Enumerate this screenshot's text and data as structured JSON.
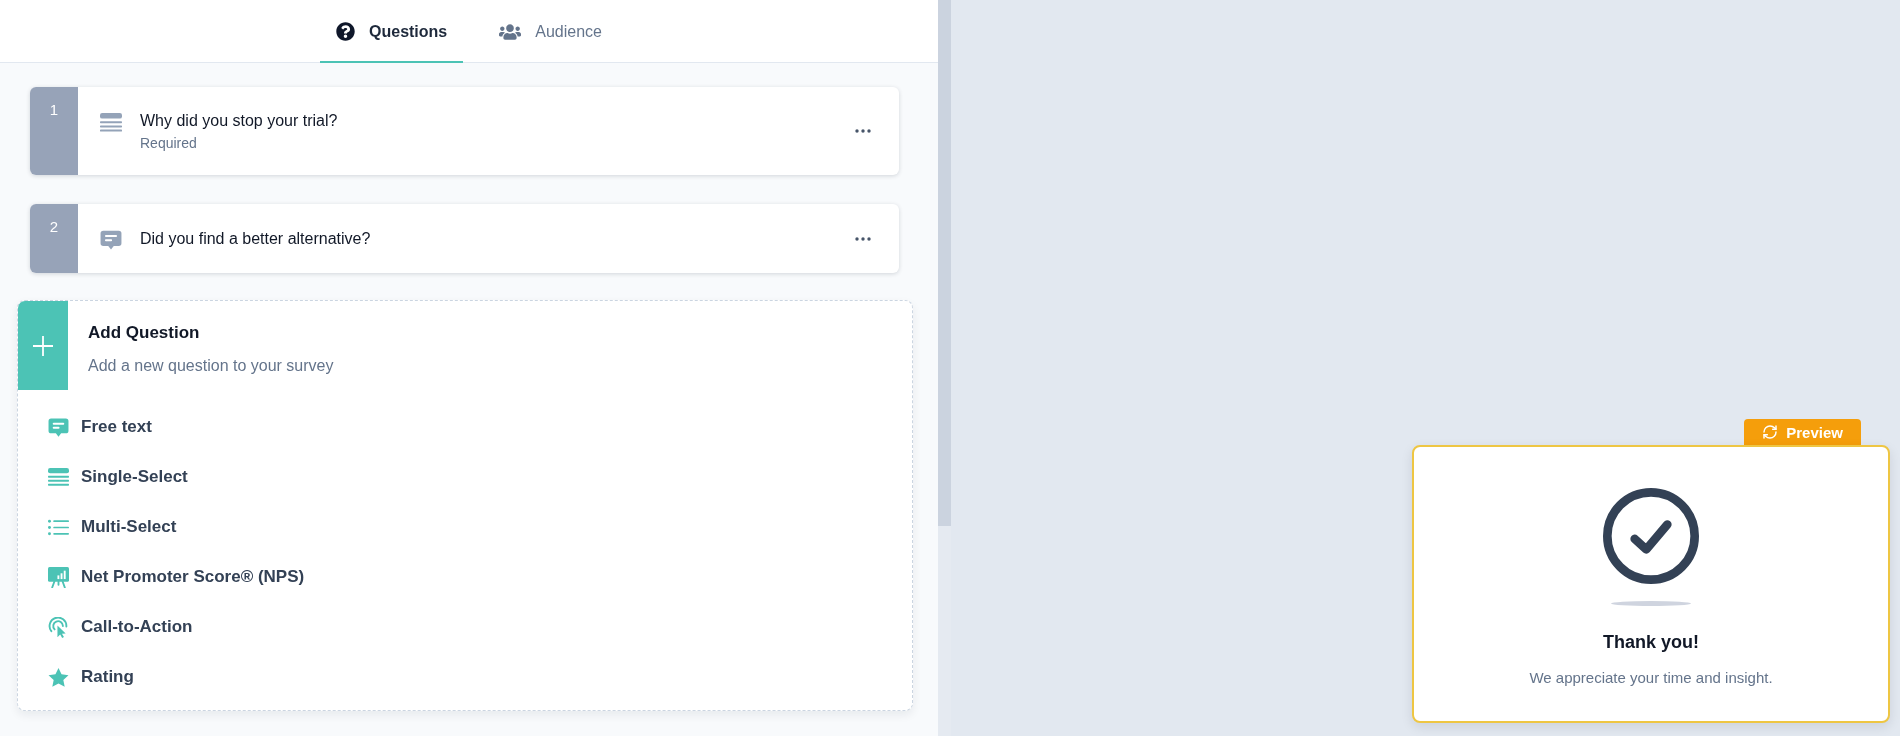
{
  "tabs": [
    {
      "label": "Questions",
      "kind": "question",
      "selected": true
    },
    {
      "label": "Audience",
      "kind": "audience",
      "selected": false
    }
  ],
  "questions": [
    {
      "number": "1",
      "kind": "single-select",
      "title": "Why did you stop your trial?",
      "subtitle": "Required"
    },
    {
      "number": "2",
      "kind": "free-text",
      "title": "Did you find a better alternative?"
    }
  ],
  "add_question": {
    "title": "Add Question",
    "subtitle": "Add a new question to your survey",
    "types": [
      {
        "label": "Free text",
        "kind": "free-text"
      },
      {
        "label": "Single-Select",
        "kind": "single-select"
      },
      {
        "label": "Multi-Select",
        "kind": "multi-select"
      },
      {
        "label": "Net Promoter Score® (NPS)",
        "kind": "nps"
      },
      {
        "label": "Call-to-Action",
        "kind": "cta"
      },
      {
        "label": "Rating",
        "kind": "rating"
      }
    ]
  },
  "preview": {
    "badge": "Preview",
    "title": "Thank you!",
    "message": "We appreciate your time and insight."
  }
}
